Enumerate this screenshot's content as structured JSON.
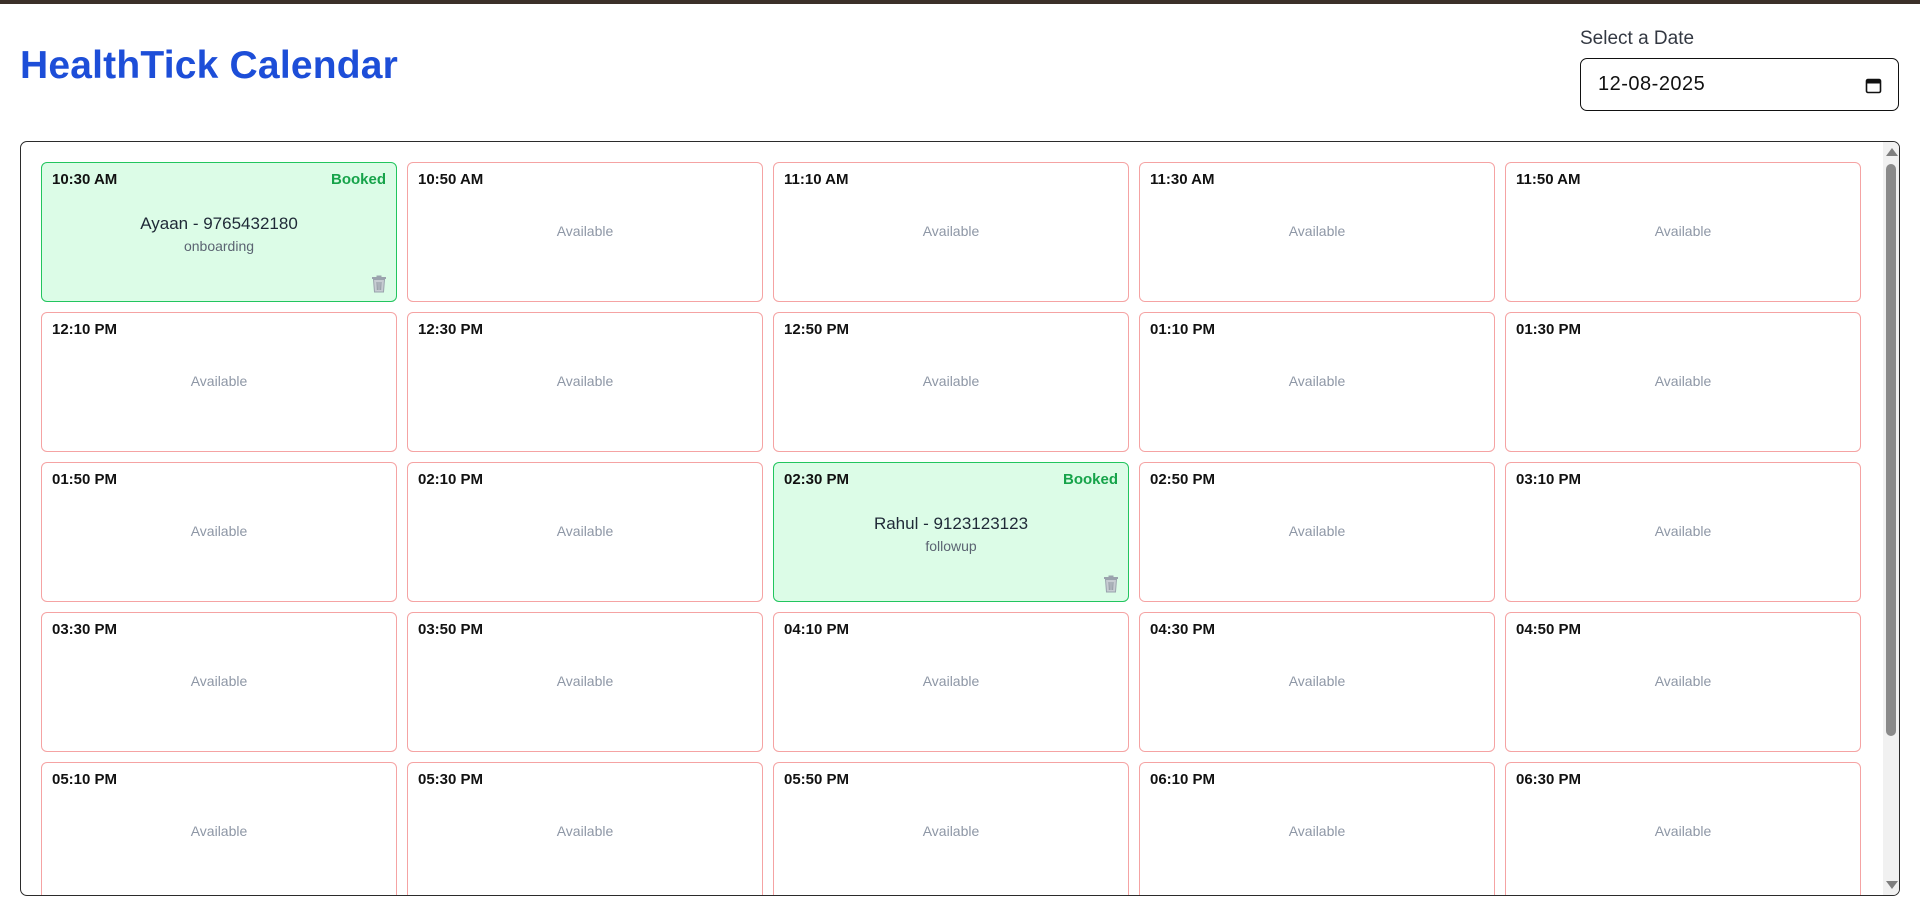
{
  "header": {
    "title": "HealthTick Calendar",
    "date_label": "Select a Date",
    "date_value": "12-08-2025"
  },
  "colors": {
    "title": "#1d4ed8",
    "booked_border": "#22c55e",
    "booked_bg": "#dcfce7",
    "available_border": "#f5a3a3"
  },
  "icons": {
    "date_picker": "calendar-icon",
    "delete": "trash-icon"
  },
  "slots": [
    {
      "time": "10:30 AM",
      "booked": true,
      "status": "Booked",
      "name": "Ayaan - 9765432180",
      "type": "onboarding"
    },
    {
      "time": "10:50 AM",
      "booked": false,
      "label": "Available"
    },
    {
      "time": "11:10 AM",
      "booked": false,
      "label": "Available"
    },
    {
      "time": "11:30 AM",
      "booked": false,
      "label": "Available"
    },
    {
      "time": "11:50 AM",
      "booked": false,
      "label": "Available"
    },
    {
      "time": "12:10 PM",
      "booked": false,
      "label": "Available"
    },
    {
      "time": "12:30 PM",
      "booked": false,
      "label": "Available"
    },
    {
      "time": "12:50 PM",
      "booked": false,
      "label": "Available"
    },
    {
      "time": "01:10 PM",
      "booked": false,
      "label": "Available"
    },
    {
      "time": "01:30 PM",
      "booked": false,
      "label": "Available"
    },
    {
      "time": "01:50 PM",
      "booked": false,
      "label": "Available"
    },
    {
      "time": "02:10 PM",
      "booked": false,
      "label": "Available"
    },
    {
      "time": "02:30 PM",
      "booked": true,
      "status": "Booked",
      "name": "Rahul - 9123123123",
      "type": "followup"
    },
    {
      "time": "02:50 PM",
      "booked": false,
      "label": "Available"
    },
    {
      "time": "03:10 PM",
      "booked": false,
      "label": "Available"
    },
    {
      "time": "03:30 PM",
      "booked": false,
      "label": "Available"
    },
    {
      "time": "03:50 PM",
      "booked": false,
      "label": "Available"
    },
    {
      "time": "04:10 PM",
      "booked": false,
      "label": "Available"
    },
    {
      "time": "04:30 PM",
      "booked": false,
      "label": "Available"
    },
    {
      "time": "04:50 PM",
      "booked": false,
      "label": "Available"
    },
    {
      "time": "05:10 PM",
      "booked": false,
      "label": "Available"
    },
    {
      "time": "05:30 PM",
      "booked": false,
      "label": "Available"
    },
    {
      "time": "05:50 PM",
      "booked": false,
      "label": "Available"
    },
    {
      "time": "06:10 PM",
      "booked": false,
      "label": "Available"
    },
    {
      "time": "06:30 PM",
      "booked": false,
      "label": "Available"
    }
  ]
}
